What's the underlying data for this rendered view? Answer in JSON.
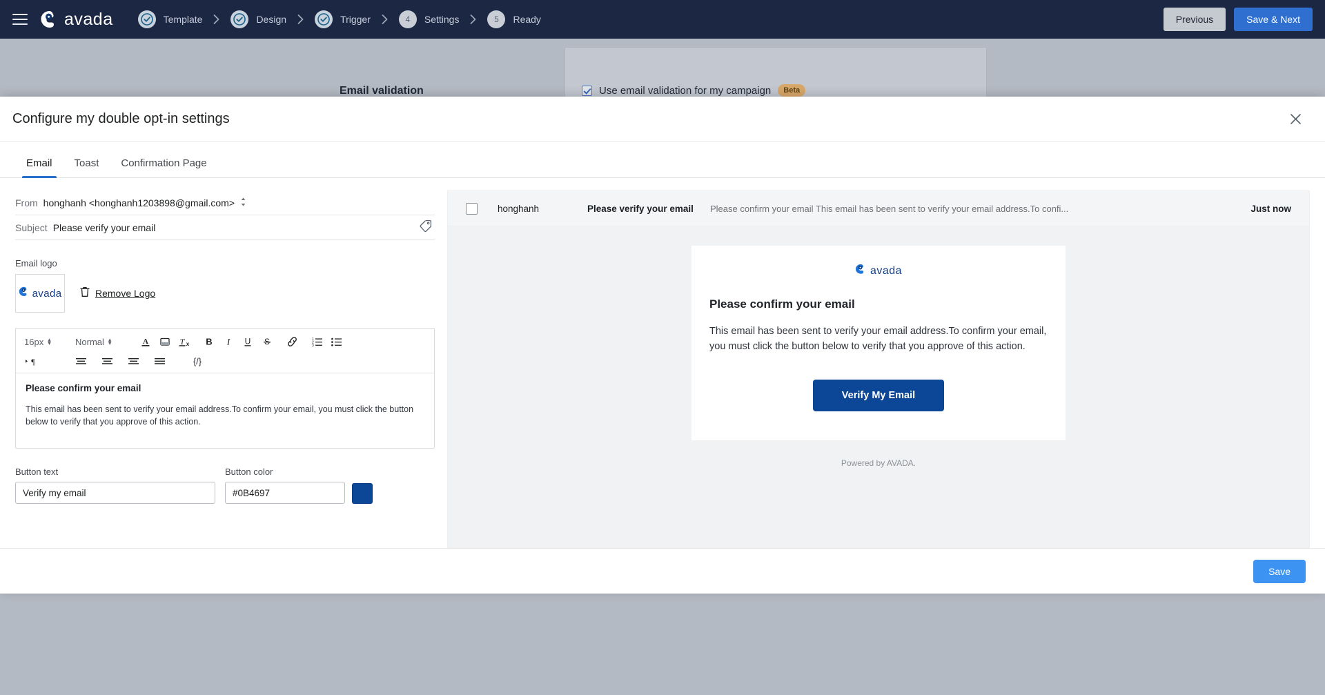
{
  "topbar": {
    "brand": "avada",
    "menu_icon": "hamburger-icon",
    "steps": [
      {
        "badge": "check",
        "label": "Template",
        "state": "done"
      },
      {
        "badge": "check",
        "label": "Design",
        "state": "done"
      },
      {
        "badge": "check",
        "label": "Trigger",
        "state": "done"
      },
      {
        "badge": "4",
        "label": "Settings",
        "state": "current"
      },
      {
        "badge": "5",
        "label": "Ready",
        "state": "pending"
      }
    ],
    "previous_label": "Previous",
    "save_next_label": "Save & Next",
    "bg_color": "#1c2744",
    "accent_color": "#2e6fd0"
  },
  "behind": {
    "section_label": "Email validation",
    "checkbox_label": "Use email validation for my campaign",
    "beta_badge": "Beta"
  },
  "modal": {
    "title": "Configure my double opt-in settings",
    "close_icon": "close-icon",
    "save_label": "Save",
    "tabs": [
      {
        "label": "Email",
        "active": true
      },
      {
        "label": "Toast",
        "active": false
      },
      {
        "label": "Confirmation Page",
        "active": false
      }
    ]
  },
  "form": {
    "from_label": "From",
    "from_value": "honghanh <honghanh1203898@gmail.com>",
    "subject_label": "Subject",
    "subject_value": "Please verify your email",
    "tag_icon": "tag-icon",
    "email_logo_label": "Email logo",
    "logo_text": "avada",
    "remove_logo_label": "Remove Logo",
    "trash_icon": "trash-icon",
    "button_text_label": "Button text",
    "button_text_value": "Verify my email",
    "button_color_label": "Button color",
    "button_color_value": "#0B4697"
  },
  "toolbar": {
    "font_size": "16px",
    "format": "Normal",
    "buttons": [
      {
        "name": "text-color-icon",
        "glyph": "A"
      },
      {
        "name": "background-color-icon",
        "glyph": "bg"
      },
      {
        "name": "clear-format-icon",
        "glyph": "Tx"
      },
      {
        "name": "bold-icon",
        "glyph": "B"
      },
      {
        "name": "italic-icon",
        "glyph": "I"
      },
      {
        "name": "underline-icon",
        "glyph": "U"
      },
      {
        "name": "strikethrough-icon",
        "glyph": "S"
      },
      {
        "name": "link-icon",
        "glyph": "link"
      },
      {
        "name": "ordered-list-icon",
        "glyph": "ol"
      },
      {
        "name": "bullet-list-icon",
        "glyph": "ul"
      },
      {
        "name": "indent-icon",
        "glyph": "para"
      },
      {
        "name": "align-left-icon",
        "glyph": "al"
      },
      {
        "name": "align-center-icon",
        "glyph": "ac"
      },
      {
        "name": "align-right-icon",
        "glyph": "ar"
      },
      {
        "name": "align-justify-icon",
        "glyph": "aj"
      },
      {
        "name": "source-code-icon",
        "glyph": "{/}"
      }
    ]
  },
  "editor": {
    "heading": "Please confirm your email",
    "paragraph": "This email has been sent to verify your email address.To confirm your email, you must click the button below to verify that you approve of this action."
  },
  "preview": {
    "inbox": {
      "from": "honghanh",
      "subject": "Please verify your email",
      "snippet": "Please confirm your email This email has been sent to verify your email address.To confi...",
      "time": "Just now"
    },
    "mail": {
      "logo_text": "avada",
      "heading": "Please confirm your email",
      "paragraph": "This email has been sent to verify your email address.To confirm your email, you must click the button below to verify that you approve of this action.",
      "button_label": "Verify My Email",
      "button_color": "#0B4697",
      "footer": "Powered by AVADA."
    }
  }
}
